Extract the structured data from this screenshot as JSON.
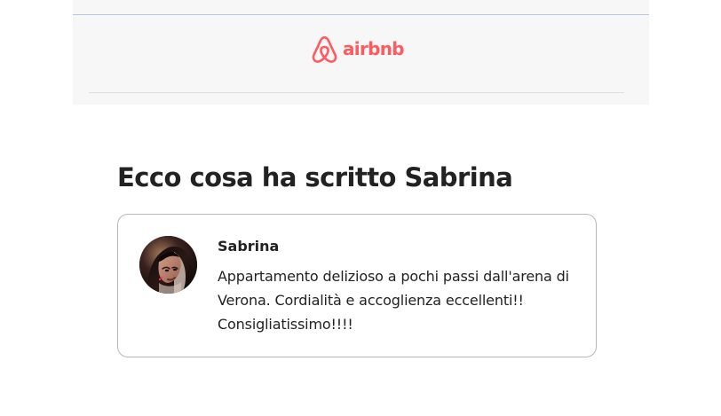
{
  "header": {
    "brand": "airbnb",
    "logo_icon": "airbnb-logo-icon",
    "brand_color": "#FF5A5F",
    "background_color": "#F7F7F7",
    "top_rule_color": "#B8C7E6"
  },
  "main": {
    "title": "Ecco cosa ha scritto Sabrina"
  },
  "review": {
    "reviewer_name": "Sabrina",
    "avatar": "reviewer-avatar",
    "text": "Appartamento delizioso a pochi passi dall'arena di Verona. Cordialità e accoglienza eccellenti!! Consigliatissimo!!!!"
  }
}
